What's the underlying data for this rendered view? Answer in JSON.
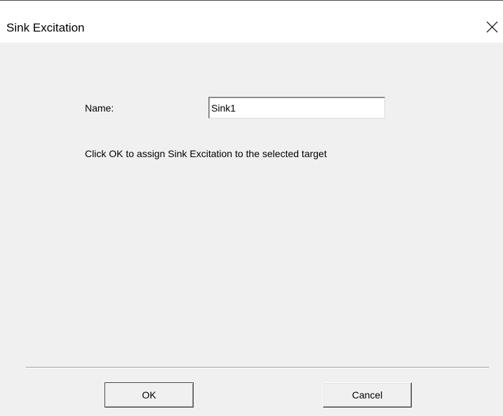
{
  "window": {
    "title": "Sink Excitation",
    "close_icon": "close-icon"
  },
  "form": {
    "name_label": "Name:",
    "name_value": "Sink1",
    "hint_text": "Click OK to assign Sink Excitation to the selected target"
  },
  "buttons": {
    "ok_label": "OK",
    "cancel_label": "Cancel"
  },
  "colors": {
    "dialog_background": "#f0f0f0",
    "titlebar_background": "#ffffff"
  }
}
